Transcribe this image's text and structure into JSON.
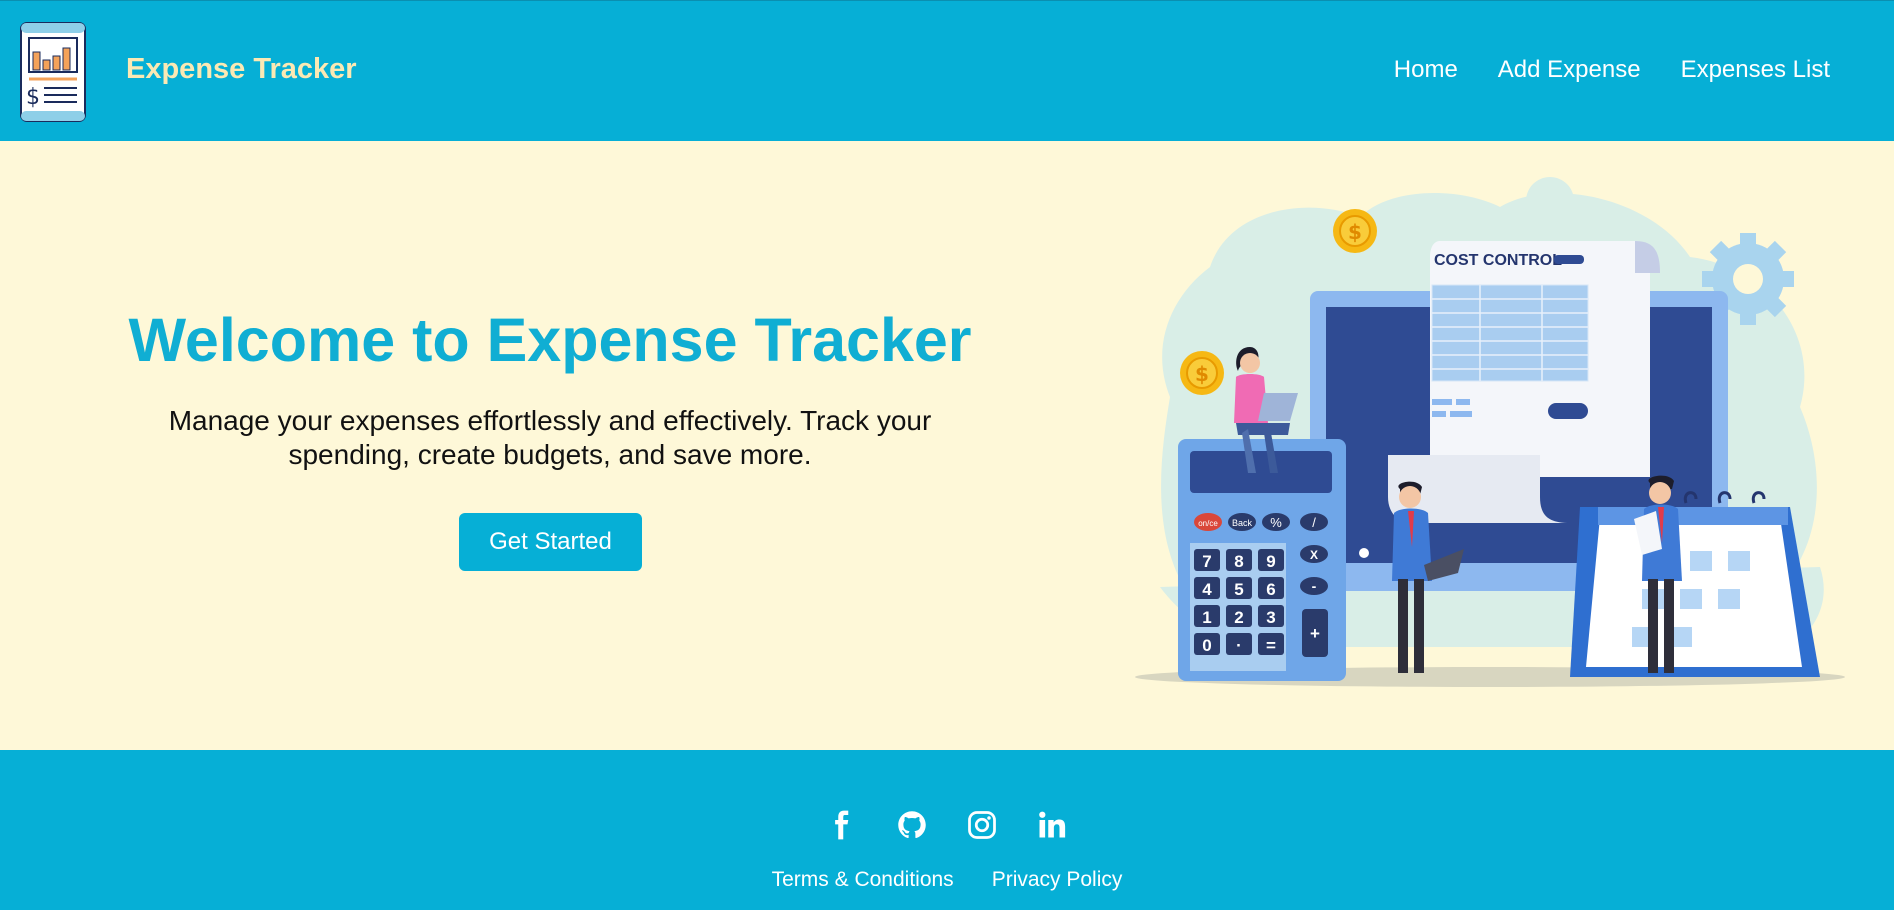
{
  "navbar": {
    "brand": "Expense Tracker",
    "links": [
      {
        "label": "Home"
      },
      {
        "label": "Add Expense"
      },
      {
        "label": "Expenses List"
      }
    ]
  },
  "hero": {
    "title": "Welcome to Expense Tracker",
    "subtitle": "Manage your expenses effortlessly and effectively. Track your spending, create budgets, and save more.",
    "cta_label": "Get Started",
    "illustration": {
      "sheet_title": "COST CONTROL",
      "coin_symbol": "$",
      "keys": [
        "on/ce",
        "Back",
        "%",
        "/",
        "7",
        "8",
        "9",
        "X",
        "4",
        "5",
        "6",
        "-",
        "1",
        "2",
        "3",
        "+",
        "0",
        "·",
        "="
      ]
    }
  },
  "footer": {
    "social": [
      "facebook-icon",
      "github-icon",
      "instagram-icon",
      "linkedin-icon"
    ],
    "links": [
      {
        "label": "Terms & Conditions"
      },
      {
        "label": "Privacy Policy"
      }
    ]
  },
  "colors": {
    "primary": "#06afd6",
    "brand_text": "#fbe9b4",
    "hero_bg": "#fef8d8",
    "title": "#10aed3"
  }
}
